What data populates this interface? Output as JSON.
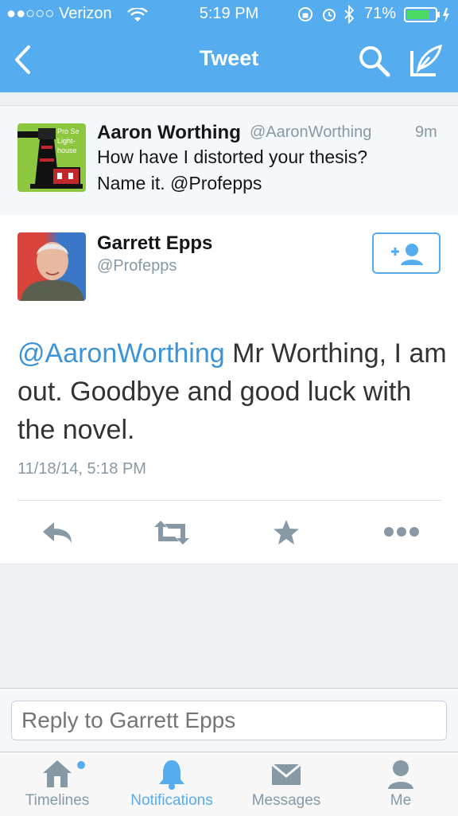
{
  "status_bar": {
    "carrier": "●●○○○ Verizon",
    "time": "5:19 PM",
    "battery": "71%"
  },
  "nav": {
    "title": "Tweet"
  },
  "context_tweet": {
    "avatar_text": "Pro Se Light- house",
    "name": "Aaron Worthing",
    "handle": "@AaronWorthing",
    "age": "9m",
    "text": "How have I distorted your thesis? Name it. @Profepps"
  },
  "main_tweet": {
    "name": "Garrett Epps",
    "handle": "@Profepps",
    "mention": "@AaronWorthing",
    "text": " Mr Worthing, I am out.  Goodbye and good luck with the novel.",
    "timestamp": "11/18/14, 5:18 PM"
  },
  "reply": {
    "placeholder": "Reply to Garrett Epps"
  },
  "tabs": [
    {
      "label": "Timelines",
      "icon": "home-icon"
    },
    {
      "label": "Notifications",
      "icon": "bell-icon"
    },
    {
      "label": "Messages",
      "icon": "envelope-icon"
    },
    {
      "label": "Me",
      "icon": "person-icon"
    }
  ],
  "colors": {
    "brand": "#55acee",
    "mention": "#3b94d9",
    "muted": "#8899a6"
  }
}
